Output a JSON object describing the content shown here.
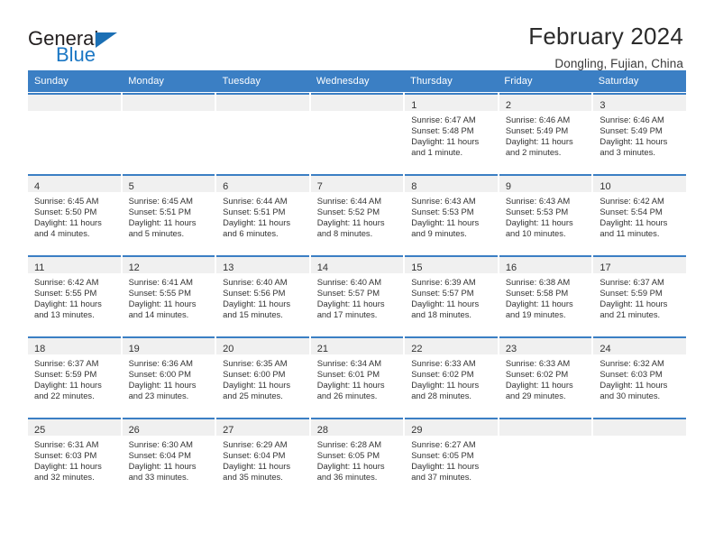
{
  "brand": {
    "name_line1": "General",
    "name_line2": "Blue",
    "triangle_color": "#1b6fb4",
    "blue_color": "#1b77c4"
  },
  "header": {
    "title": "February 2024",
    "subtitle": "Dongling, Fujian, China"
  },
  "theme": {
    "header_blue": "#3b7fc4",
    "day_band_gray": "#f0f0f0",
    "text_color": "#333333"
  },
  "weekdays": [
    "Sunday",
    "Monday",
    "Tuesday",
    "Wednesday",
    "Thursday",
    "Friday",
    "Saturday"
  ],
  "weeks": [
    [
      {
        "day": "",
        "sunrise": "",
        "sunset": "",
        "daylight1": "",
        "daylight2": ""
      },
      {
        "day": "",
        "sunrise": "",
        "sunset": "",
        "daylight1": "",
        "daylight2": ""
      },
      {
        "day": "",
        "sunrise": "",
        "sunset": "",
        "daylight1": "",
        "daylight2": ""
      },
      {
        "day": "",
        "sunrise": "",
        "sunset": "",
        "daylight1": "",
        "daylight2": ""
      },
      {
        "day": "1",
        "sunrise": "Sunrise: 6:47 AM",
        "sunset": "Sunset: 5:48 PM",
        "daylight1": "Daylight: 11 hours",
        "daylight2": "and 1 minute."
      },
      {
        "day": "2",
        "sunrise": "Sunrise: 6:46 AM",
        "sunset": "Sunset: 5:49 PM",
        "daylight1": "Daylight: 11 hours",
        "daylight2": "and 2 minutes."
      },
      {
        "day": "3",
        "sunrise": "Sunrise: 6:46 AM",
        "sunset": "Sunset: 5:49 PM",
        "daylight1": "Daylight: 11 hours",
        "daylight2": "and 3 minutes."
      }
    ],
    [
      {
        "day": "4",
        "sunrise": "Sunrise: 6:45 AM",
        "sunset": "Sunset: 5:50 PM",
        "daylight1": "Daylight: 11 hours",
        "daylight2": "and 4 minutes."
      },
      {
        "day": "5",
        "sunrise": "Sunrise: 6:45 AM",
        "sunset": "Sunset: 5:51 PM",
        "daylight1": "Daylight: 11 hours",
        "daylight2": "and 5 minutes."
      },
      {
        "day": "6",
        "sunrise": "Sunrise: 6:44 AM",
        "sunset": "Sunset: 5:51 PM",
        "daylight1": "Daylight: 11 hours",
        "daylight2": "and 6 minutes."
      },
      {
        "day": "7",
        "sunrise": "Sunrise: 6:44 AM",
        "sunset": "Sunset: 5:52 PM",
        "daylight1": "Daylight: 11 hours",
        "daylight2": "and 8 minutes."
      },
      {
        "day": "8",
        "sunrise": "Sunrise: 6:43 AM",
        "sunset": "Sunset: 5:53 PM",
        "daylight1": "Daylight: 11 hours",
        "daylight2": "and 9 minutes."
      },
      {
        "day": "9",
        "sunrise": "Sunrise: 6:43 AM",
        "sunset": "Sunset: 5:53 PM",
        "daylight1": "Daylight: 11 hours",
        "daylight2": "and 10 minutes."
      },
      {
        "day": "10",
        "sunrise": "Sunrise: 6:42 AM",
        "sunset": "Sunset: 5:54 PM",
        "daylight1": "Daylight: 11 hours",
        "daylight2": "and 11 minutes."
      }
    ],
    [
      {
        "day": "11",
        "sunrise": "Sunrise: 6:42 AM",
        "sunset": "Sunset: 5:55 PM",
        "daylight1": "Daylight: 11 hours",
        "daylight2": "and 13 minutes."
      },
      {
        "day": "12",
        "sunrise": "Sunrise: 6:41 AM",
        "sunset": "Sunset: 5:55 PM",
        "daylight1": "Daylight: 11 hours",
        "daylight2": "and 14 minutes."
      },
      {
        "day": "13",
        "sunrise": "Sunrise: 6:40 AM",
        "sunset": "Sunset: 5:56 PM",
        "daylight1": "Daylight: 11 hours",
        "daylight2": "and 15 minutes."
      },
      {
        "day": "14",
        "sunrise": "Sunrise: 6:40 AM",
        "sunset": "Sunset: 5:57 PM",
        "daylight1": "Daylight: 11 hours",
        "daylight2": "and 17 minutes."
      },
      {
        "day": "15",
        "sunrise": "Sunrise: 6:39 AM",
        "sunset": "Sunset: 5:57 PM",
        "daylight1": "Daylight: 11 hours",
        "daylight2": "and 18 minutes."
      },
      {
        "day": "16",
        "sunrise": "Sunrise: 6:38 AM",
        "sunset": "Sunset: 5:58 PM",
        "daylight1": "Daylight: 11 hours",
        "daylight2": "and 19 minutes."
      },
      {
        "day": "17",
        "sunrise": "Sunrise: 6:37 AM",
        "sunset": "Sunset: 5:59 PM",
        "daylight1": "Daylight: 11 hours",
        "daylight2": "and 21 minutes."
      }
    ],
    [
      {
        "day": "18",
        "sunrise": "Sunrise: 6:37 AM",
        "sunset": "Sunset: 5:59 PM",
        "daylight1": "Daylight: 11 hours",
        "daylight2": "and 22 minutes."
      },
      {
        "day": "19",
        "sunrise": "Sunrise: 6:36 AM",
        "sunset": "Sunset: 6:00 PM",
        "daylight1": "Daylight: 11 hours",
        "daylight2": "and 23 minutes."
      },
      {
        "day": "20",
        "sunrise": "Sunrise: 6:35 AM",
        "sunset": "Sunset: 6:00 PM",
        "daylight1": "Daylight: 11 hours",
        "daylight2": "and 25 minutes."
      },
      {
        "day": "21",
        "sunrise": "Sunrise: 6:34 AM",
        "sunset": "Sunset: 6:01 PM",
        "daylight1": "Daylight: 11 hours",
        "daylight2": "and 26 minutes."
      },
      {
        "day": "22",
        "sunrise": "Sunrise: 6:33 AM",
        "sunset": "Sunset: 6:02 PM",
        "daylight1": "Daylight: 11 hours",
        "daylight2": "and 28 minutes."
      },
      {
        "day": "23",
        "sunrise": "Sunrise: 6:33 AM",
        "sunset": "Sunset: 6:02 PM",
        "daylight1": "Daylight: 11 hours",
        "daylight2": "and 29 minutes."
      },
      {
        "day": "24",
        "sunrise": "Sunrise: 6:32 AM",
        "sunset": "Sunset: 6:03 PM",
        "daylight1": "Daylight: 11 hours",
        "daylight2": "and 30 minutes."
      }
    ],
    [
      {
        "day": "25",
        "sunrise": "Sunrise: 6:31 AM",
        "sunset": "Sunset: 6:03 PM",
        "daylight1": "Daylight: 11 hours",
        "daylight2": "and 32 minutes."
      },
      {
        "day": "26",
        "sunrise": "Sunrise: 6:30 AM",
        "sunset": "Sunset: 6:04 PM",
        "daylight1": "Daylight: 11 hours",
        "daylight2": "and 33 minutes."
      },
      {
        "day": "27",
        "sunrise": "Sunrise: 6:29 AM",
        "sunset": "Sunset: 6:04 PM",
        "daylight1": "Daylight: 11 hours",
        "daylight2": "and 35 minutes."
      },
      {
        "day": "28",
        "sunrise": "Sunrise: 6:28 AM",
        "sunset": "Sunset: 6:05 PM",
        "daylight1": "Daylight: 11 hours",
        "daylight2": "and 36 minutes."
      },
      {
        "day": "29",
        "sunrise": "Sunrise: 6:27 AM",
        "sunset": "Sunset: 6:05 PM",
        "daylight1": "Daylight: 11 hours",
        "daylight2": "and 37 minutes."
      },
      {
        "day": "",
        "sunrise": "",
        "sunset": "",
        "daylight1": "",
        "daylight2": ""
      },
      {
        "day": "",
        "sunrise": "",
        "sunset": "",
        "daylight1": "",
        "daylight2": ""
      }
    ]
  ]
}
